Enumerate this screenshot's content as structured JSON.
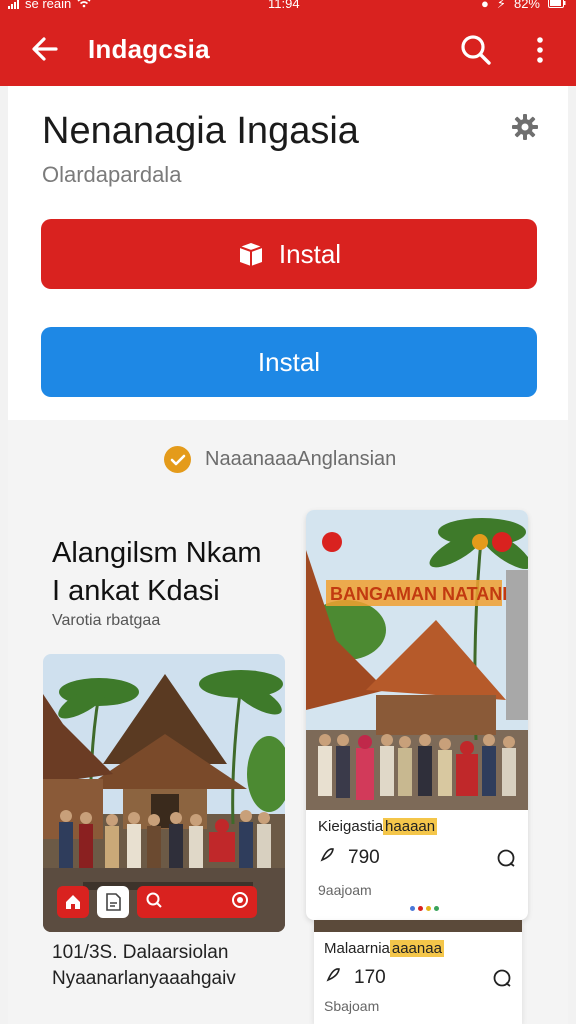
{
  "status": {
    "carrier": "ѕe reain",
    "time": "11:94",
    "battery": "82%"
  },
  "appbar": {
    "title": "Indagcsia"
  },
  "app": {
    "name": "Nenanagia Ingasia",
    "developer": "Olardapardala"
  },
  "buttons": {
    "install_primary": "Instal",
    "install_secondary": "Instal"
  },
  "verified": {
    "text": "NaaanaaaAnglansian"
  },
  "feature": {
    "title_line1": "Alangilsm Nkam",
    "title_line2": "I ankat Kdasi",
    "subtitle": "Varotia rbatgaa"
  },
  "banner_text": "BANGAMAN NATANI",
  "left_post": {
    "caption_line1": "101/3S. Dalaarsiolan",
    "caption_line2": "Nyaanarlanyaaahgaiv"
  },
  "right_post": {
    "label_main": "Kieigastia",
    "label_hi": "haaaan",
    "likes": "790",
    "time": "9aajoam"
  },
  "right_post2": {
    "label_main": "Malaarnia",
    "label_hi": "aaanaa",
    "likes": "170",
    "time": "Sbajoam"
  },
  "colors": {
    "brand_red": "#d9221f",
    "accent_blue": "#1e88e5",
    "verified_orange": "#e49b1b"
  }
}
